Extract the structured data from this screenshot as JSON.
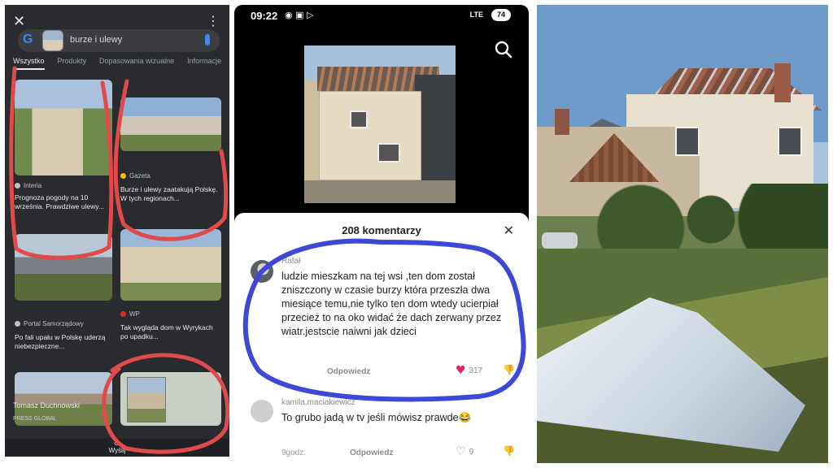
{
  "panel1": {
    "query": "burze i ulewy",
    "tabs": [
      "Wszystko",
      "Produkty",
      "Dopasowania wizualne",
      "Informacje"
    ],
    "results": [
      {
        "source": "Interia",
        "caption": "Prognoza pogody na 10 września. Prawdziwe ulewy..."
      },
      {
        "source": "Gazeta",
        "caption": "Burze i ulewy zaatakują Polskę. W tych regionach..."
      },
      {
        "source": "Portal Samorządowy",
        "caption": "Po fali upału w Polskę uderzą niebezpieczne..."
      },
      {
        "source": "WP",
        "caption": "Tak wygląda dom w Wyrykach po upadku..."
      },
      {
        "source": "Tomasz Duchnowski",
        "caption": "PRESS GLOBAL"
      },
      {
        "source": "",
        "caption": ""
      }
    ],
    "share_label": "Wyślij",
    "scribble_color": "#e04a4a"
  },
  "panel2": {
    "time": "09:22",
    "status_icons": "◉ ▣ ▷",
    "network": "LTE",
    "battery": "74",
    "comments_title": "208 komentarzy",
    "comments": [
      {
        "user": "Rafał",
        "text": "ludzie mieszkam na tej wsi ,ten dom został zniszczony w czasie burzy która przeszła dwa miesiące temu,nie tylko ten dom wtedy ucierpiał przecież to na oko widać że dach zerwany przez wiatr.jestscie naiwni jak dzieci",
        "reply": "Odpowiedz",
        "likes": "317",
        "liked": true
      },
      {
        "user": "kamila.maciakiewicz",
        "text": "To grubo jadą w tv jeśli mówisz prawde😂",
        "time": "9godz.",
        "reply": "Odpowiedz",
        "likes": "9",
        "liked": false
      }
    ],
    "scribble_color": "#3d47d8"
  },
  "colors": {
    "lens_bg": "#2a2b2e",
    "like_red": "#e0245e"
  }
}
